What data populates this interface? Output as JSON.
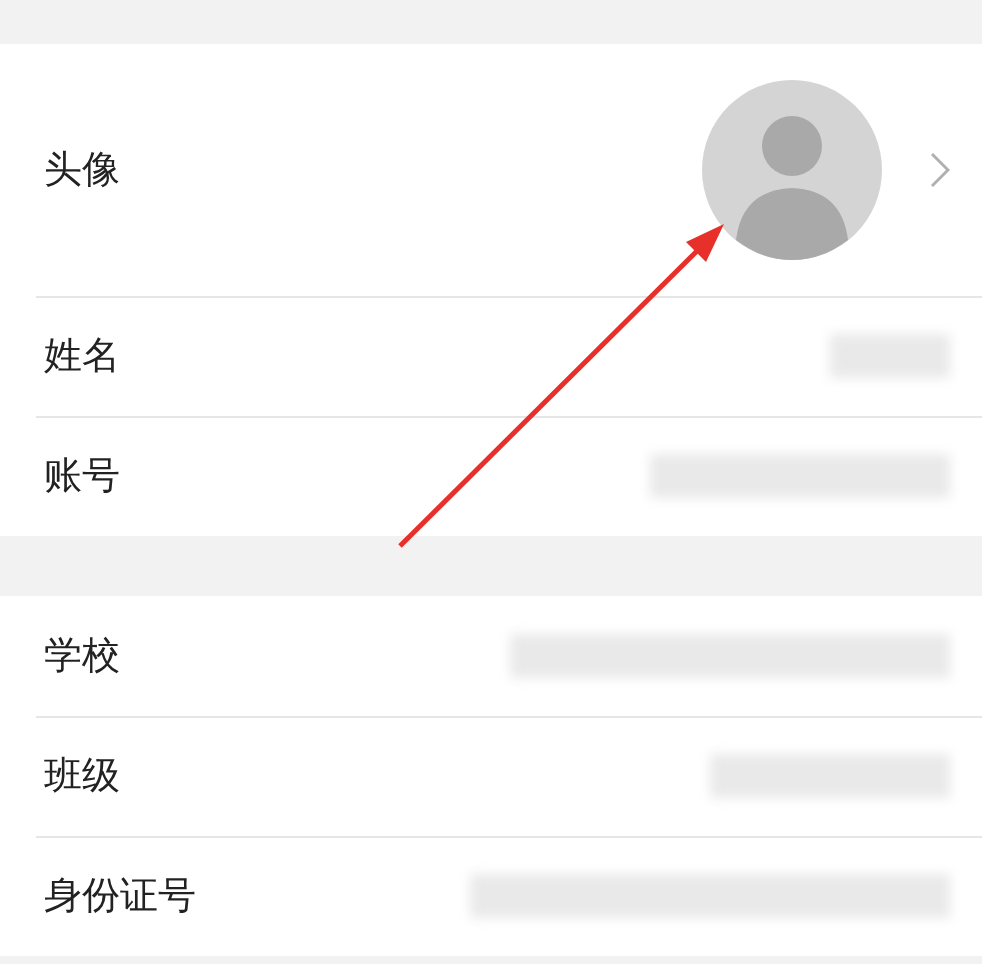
{
  "sections": [
    {
      "rows": [
        {
          "kind": "avatar",
          "label": "头像"
        },
        {
          "kind": "value",
          "label": "姓名"
        },
        {
          "kind": "value",
          "label": "账号"
        }
      ]
    },
    {
      "rows": [
        {
          "kind": "value",
          "label": "学校"
        },
        {
          "kind": "value",
          "label": "班级"
        },
        {
          "kind": "value",
          "label": "身份证号"
        }
      ]
    }
  ]
}
